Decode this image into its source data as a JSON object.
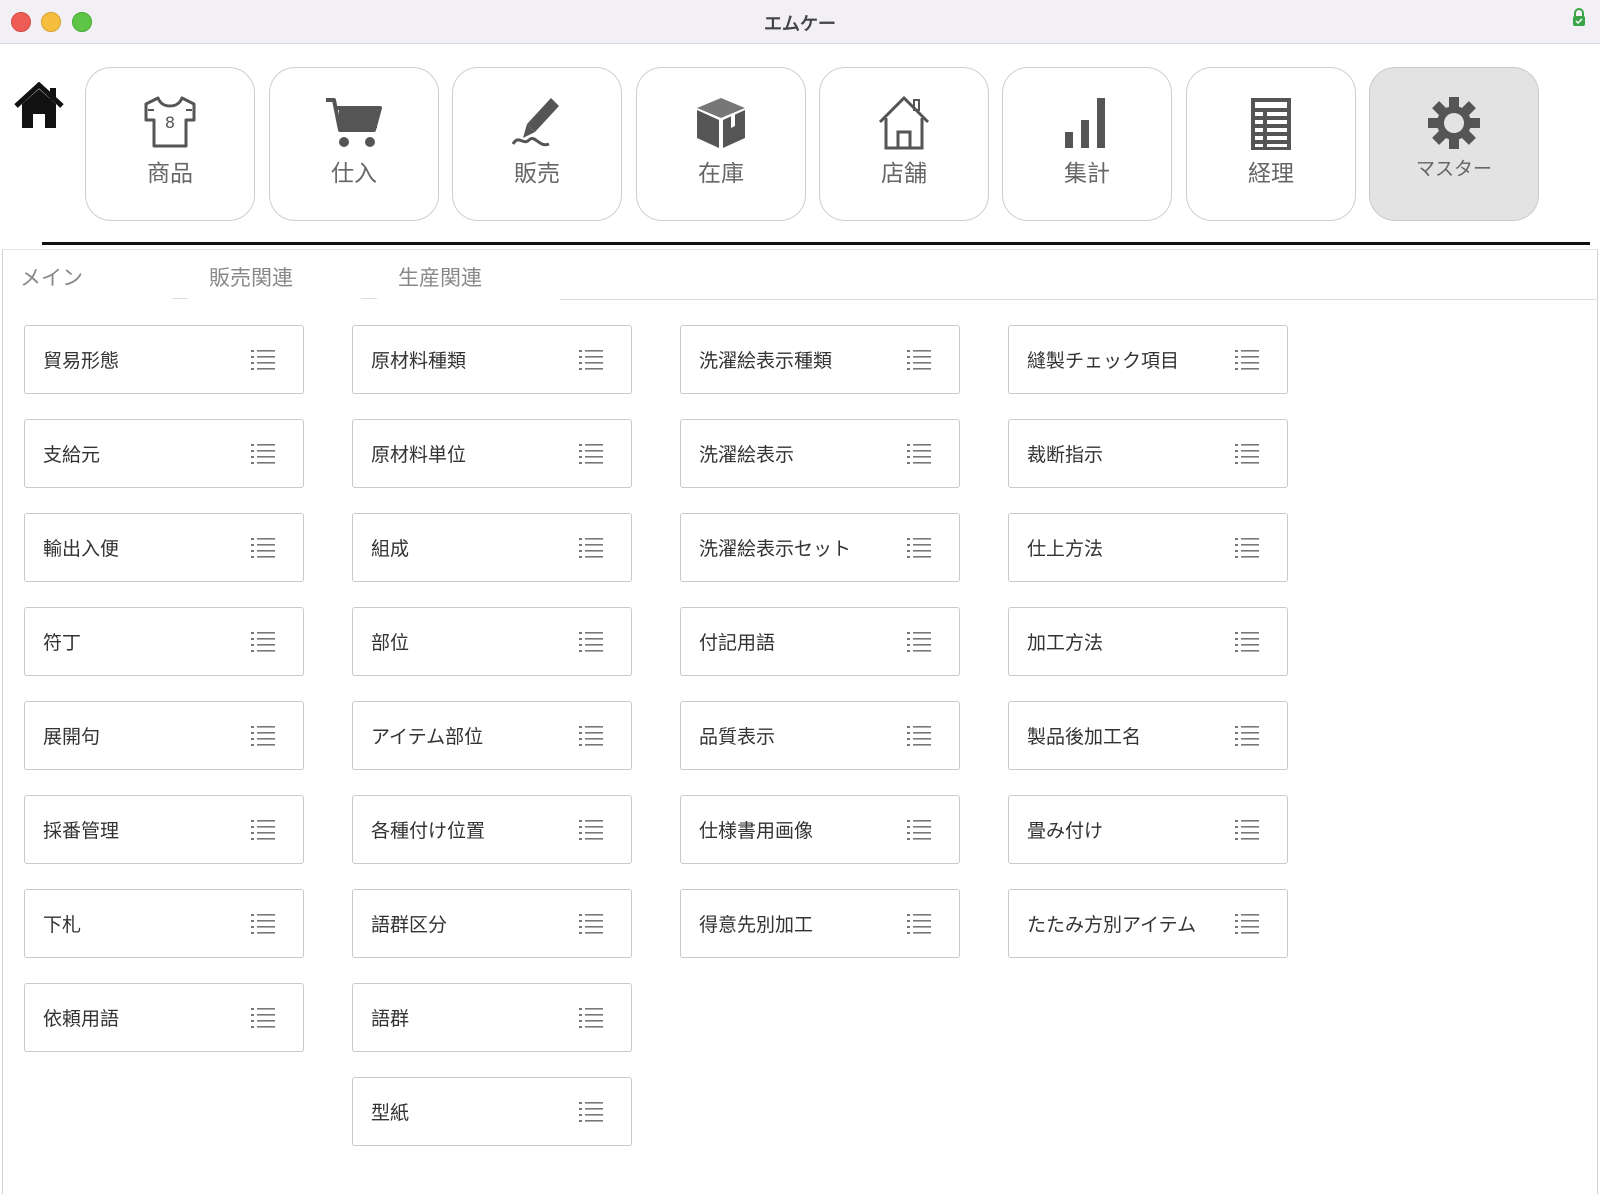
{
  "window": {
    "title": "エムケー"
  },
  "nav": [
    {
      "label": "商品",
      "icon": "shirt-icon"
    },
    {
      "label": "仕入",
      "icon": "cart-icon"
    },
    {
      "label": "販売",
      "icon": "pen-icon"
    },
    {
      "label": "在庫",
      "icon": "box-icon"
    },
    {
      "label": "店舗",
      "icon": "store-icon"
    },
    {
      "label": "集計",
      "icon": "bar-chart-icon"
    },
    {
      "label": "経理",
      "icon": "ledger-icon"
    },
    {
      "label": "マスター",
      "icon": "gear-icon",
      "active": true
    }
  ],
  "tabs": [
    {
      "label": "メイン",
      "active": true
    },
    {
      "label": "販売関連"
    },
    {
      "label": "生産関連"
    }
  ],
  "columns": [
    [
      "貿易形態",
      "支給元",
      "輸出入便",
      "符丁",
      "展開句",
      "採番管理",
      "下札",
      "依頼用語"
    ],
    [
      "原材料種類",
      "原材料単位",
      "組成",
      "部位",
      "アイテム部位",
      "各種付け位置",
      "語群区分",
      "語群",
      "型紙"
    ],
    [
      "洗濯絵表示種類",
      "洗濯絵表示",
      "洗濯絵表示セット",
      "付記用語",
      "品質表示",
      "仕様書用画像",
      "得意先別加工"
    ],
    [
      "縫製チェック項目",
      "裁断指示",
      "仕上方法",
      "加工方法",
      "製品後加工名",
      "畳み付け",
      "たたみ方別アイテム"
    ]
  ],
  "colors": {
    "active_nav_bg": "#e3e3e3",
    "close": "#ee5d55",
    "minimize": "#f5be3e",
    "maximize": "#5dc646"
  }
}
